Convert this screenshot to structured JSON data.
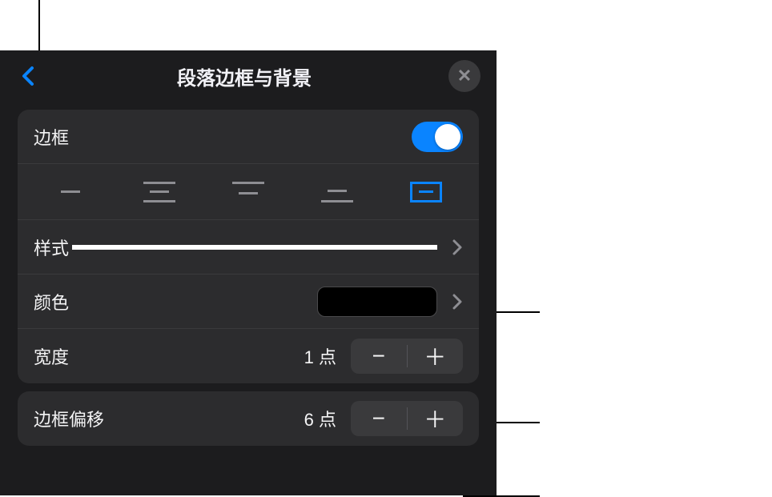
{
  "header": {
    "title": "段落边框与背景"
  },
  "border": {
    "toggle_label": "边框",
    "toggle_on": true
  },
  "style": {
    "label": "样式"
  },
  "color": {
    "label": "颜色",
    "value_hex": "#000000"
  },
  "width": {
    "label": "宽度",
    "value": "1 点"
  },
  "offset": {
    "label": "边框偏移",
    "value": "6 点"
  },
  "icons": {
    "minus": "−",
    "plus": "＋",
    "close": "✕"
  }
}
